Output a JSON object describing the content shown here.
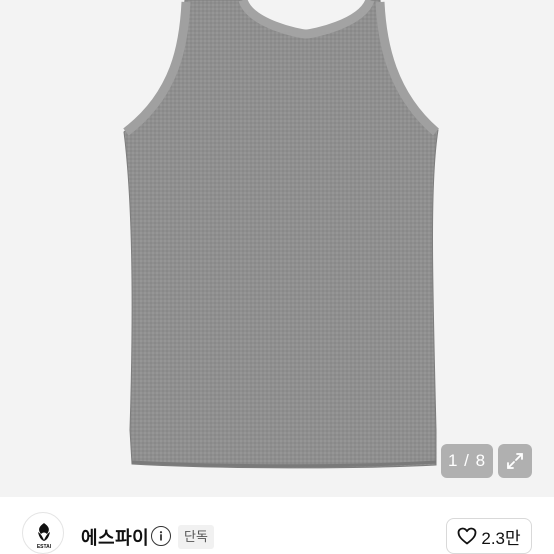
{
  "product": {
    "image_counter": "1 / 8",
    "image_alt": "gray sleeveless tank top"
  },
  "store": {
    "logo_text": "ESTAI",
    "name": "에스파이",
    "badge": "단독"
  },
  "like": {
    "count": "2.3만"
  },
  "icons": {
    "expand": "expand-icon",
    "info": "info-icon",
    "heart": "heart-icon"
  }
}
